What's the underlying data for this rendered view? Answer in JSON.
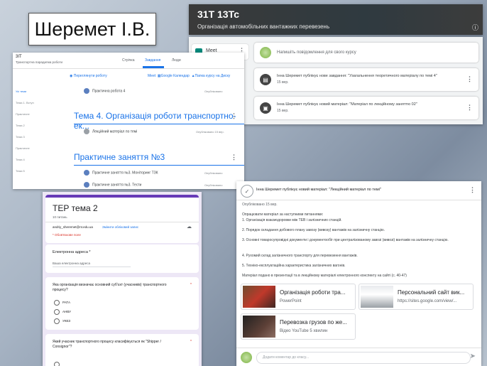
{
  "name_label": "Шеремет І.В.",
  "banner": {
    "title": "31Т 13Тс",
    "subtitle": "Організація автомобільних вантажних перевезень"
  },
  "stream": {
    "meet_label": "Meet",
    "share_placeholder": "Напишіть повідомлення для свого курсу",
    "posts": [
      {
        "text": "Інна Шеремет публікує нове завдання: \"Узагальнення теоретичного матеріалу по темі 4\"",
        "date": "15 вер."
      },
      {
        "text": "Інна Шеремет публікує новий матеріал: \"Матеріал по лекційному заняттю 02\"",
        "date": "15 вер."
      }
    ]
  },
  "classwork": {
    "course_short": "3ІТ",
    "course_sub": "Транспортна парадигма роботи",
    "tabs": [
      "Стрічка",
      "Завдання",
      "Люди"
    ],
    "active_tab": "Завдання",
    "sidebar": [
      "Усі теми",
      "Тема 1. Вступ",
      "Практичне",
      "Тема 2",
      "Тема 3",
      "Практичне",
      "Тема 4",
      "Тема 5"
    ],
    "toolbar": {
      "create": "Переглянути роботу",
      "meet": "Meet",
      "calendar": "Google Календар",
      "drive": "Папка курсу на Диску"
    },
    "items": [
      {
        "label": "Практична робота 4",
        "date": "Опубліковано"
      },
      {
        "label": "Лекційний матеріал по темі",
        "date": "Опубліковано 15 вер."
      },
      {
        "label": "Практичне заняття №3. Моніторинг ТЗК",
        "date": "Опубліковано"
      },
      {
        "label": "Практичне заняття №3. Тести",
        "date": "Опубліковано"
      }
    ],
    "topic4": "Тема 4. Організація роботи транспортно-ек...",
    "topic_practice": "Практичне заняття №3"
  },
  "form": {
    "title": "ТЕР тема 2",
    "points": "10 питань",
    "account": "andriy_sheremet@nt.edu.ua",
    "switch_account": "Змінити обліковий запис",
    "required_note": "* Обов'язкове поле",
    "email_label": "Електронна адреса *",
    "email_placeholder": "Ваша електронна адреса",
    "q1": "Яка організація визначає основний субʼєкт (учасників) транспортного процесу?",
    "q1_options": [
      "РАТА",
      "АНВУ",
      "УКЕЗ"
    ],
    "q2": "Який учасник транспортного процесу класифікується як \"Shipper / Consignor\"?"
  },
  "material": {
    "header": "Інна Шеремет публікує новий матеріал: \"Лекційний матеріал по темі\"",
    "meta": "Опубліковано 15 вер.",
    "intro": "Опрацювати матеріал за наступними питаннями:",
    "p1": "1. Організація взаємодоровки між ТЕВ і залізничних станцій.",
    "p2": "2. Порядок складання добового плану завозу (вивозу) вантажів на залізничну станцію.",
    "p3": "3. Основні товаросупровідні документи і документообіг при централізованому завозі (вивозі) вантажів на залізничну станцію.",
    "p4": "4. Рухомий склад залізничного транспорту для перевезення вантажів.",
    "p5": "5. Техніко-експлуатаційна характеристика залізничних вагонів.",
    "closing": "Матеріал подано в презентації та в лекційному матеріалі електронного конспекту на сайті (с. 40-47)",
    "attachments": [
      {
        "title": "Організація роботи тра...",
        "sub": "PowerPoint"
      },
      {
        "title": "Персональний сайт вик...",
        "sub": "https://sites.google.com/view/..."
      },
      {
        "title": "Перевозка грузов по же...",
        "sub": "Відео YouTube   5 хвилин"
      }
    ],
    "comment_placeholder": "Додати коментар до класу..."
  },
  "colors": {
    "accent": "#1a73e8",
    "form_accent": "#673ab7"
  }
}
